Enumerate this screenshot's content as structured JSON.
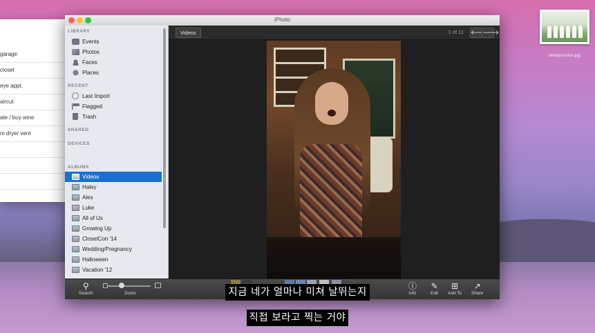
{
  "reminders": {
    "title": ":",
    "items": [
      "garage",
      "closet",
      "eye appt.",
      "aircut",
      "ate / buy wine",
      "m dryer vent"
    ]
  },
  "desktop_file": {
    "name": "familyreunion.jpg"
  },
  "window": {
    "title": "iPhoto"
  },
  "sidebar": {
    "library": {
      "header": "LIBRARY",
      "items": [
        {
          "label": "Events",
          "icon": "events-icon"
        },
        {
          "label": "Photos",
          "icon": "photos-icon"
        },
        {
          "label": "Faces",
          "icon": "faces-icon"
        },
        {
          "label": "Places",
          "icon": "places-icon"
        }
      ]
    },
    "recent": {
      "header": "RECENT",
      "items": [
        {
          "label": "Last Import",
          "icon": "clock-icon"
        },
        {
          "label": "Flagged",
          "icon": "flag-icon"
        },
        {
          "label": "Trash",
          "icon": "trash-icon"
        }
      ]
    },
    "shared": {
      "header": "SHARED"
    },
    "devices": {
      "header": "DEVICES"
    },
    "albums": {
      "header": "ALBUMS",
      "items": [
        "Videos",
        "Haley",
        "Alex",
        "Luke",
        "All of Us",
        "Growing Up",
        "ClosetCon '14",
        "Wedding/Pregnancy",
        "Halloween",
        "Vacation '12"
      ],
      "selected": "Videos"
    }
  },
  "main": {
    "back_button": "Videos",
    "counter": "1 of 11",
    "prev_glyph": "🡐",
    "next_glyph": "🡒"
  },
  "toolbar": {
    "search": "Search",
    "zoom": "Zoom",
    "info": "Info",
    "edit": "Edit",
    "add_to": "Add To",
    "share": "Share"
  },
  "subtitles": {
    "line1": "지금 네가 얼마나 미쳐 날뛰는지",
    "line2": "직접 보라고 찍는 거야"
  }
}
